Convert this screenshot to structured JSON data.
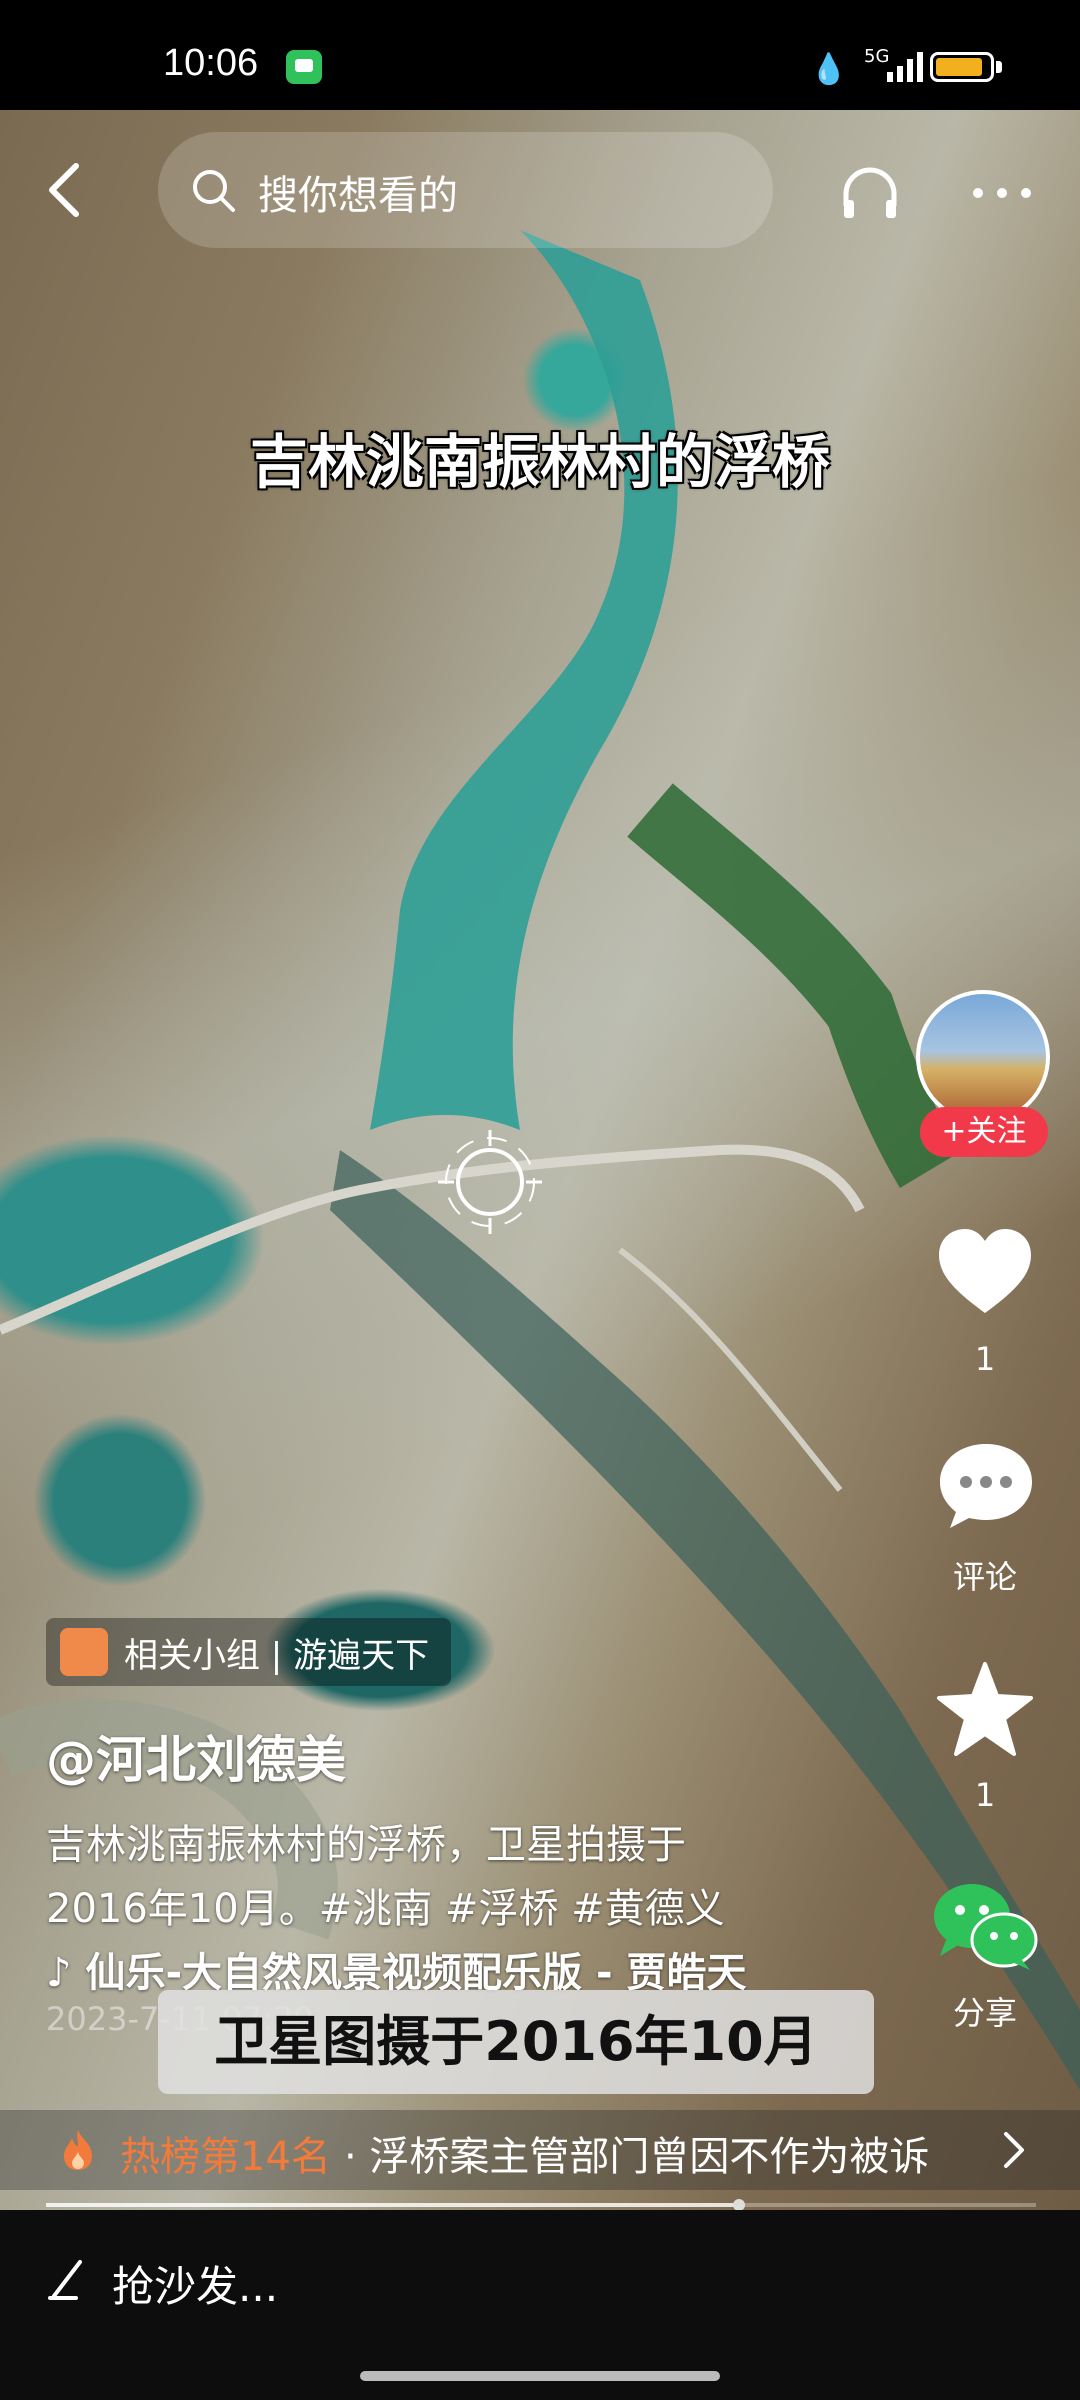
{
  "status_bar": {
    "time": "10:06",
    "network": "5G"
  },
  "search": {
    "placeholder": "搜你想看的"
  },
  "video": {
    "title_overlay": "吉林洮南振林村的浮桥",
    "caption_overlay": "卫星图摄于2016年10月"
  },
  "side_actions": {
    "follow_label": "+关注",
    "like_count": "1",
    "comment_label": "评论",
    "favorite_count": "1",
    "share_label": "分享"
  },
  "info": {
    "group_tag": "相关小组 | 游遍天下",
    "author": "@河北刘德美",
    "description_line1": "吉林洮南振林村的浮桥，卫星拍摄于",
    "description_line2": "2016年10月。#洮南 #浮桥 #黄德义",
    "music": "♪ 仙乐-大自然风景视频配乐版 - 贾皓天",
    "date": "2023-7-11 07:29"
  },
  "hot": {
    "rank": "热榜第14名",
    "headline": "· 浮桥案主管部门曾因不作为被诉"
  },
  "playback": {
    "progress_fraction": 0.7
  },
  "comment_bar": {
    "placeholder": "抢沙发..."
  },
  "colors": {
    "follow": "#f2394a",
    "hot_rank": "#f27a3a",
    "battery": "#f2b01e",
    "wechat": "#2fc25b"
  }
}
